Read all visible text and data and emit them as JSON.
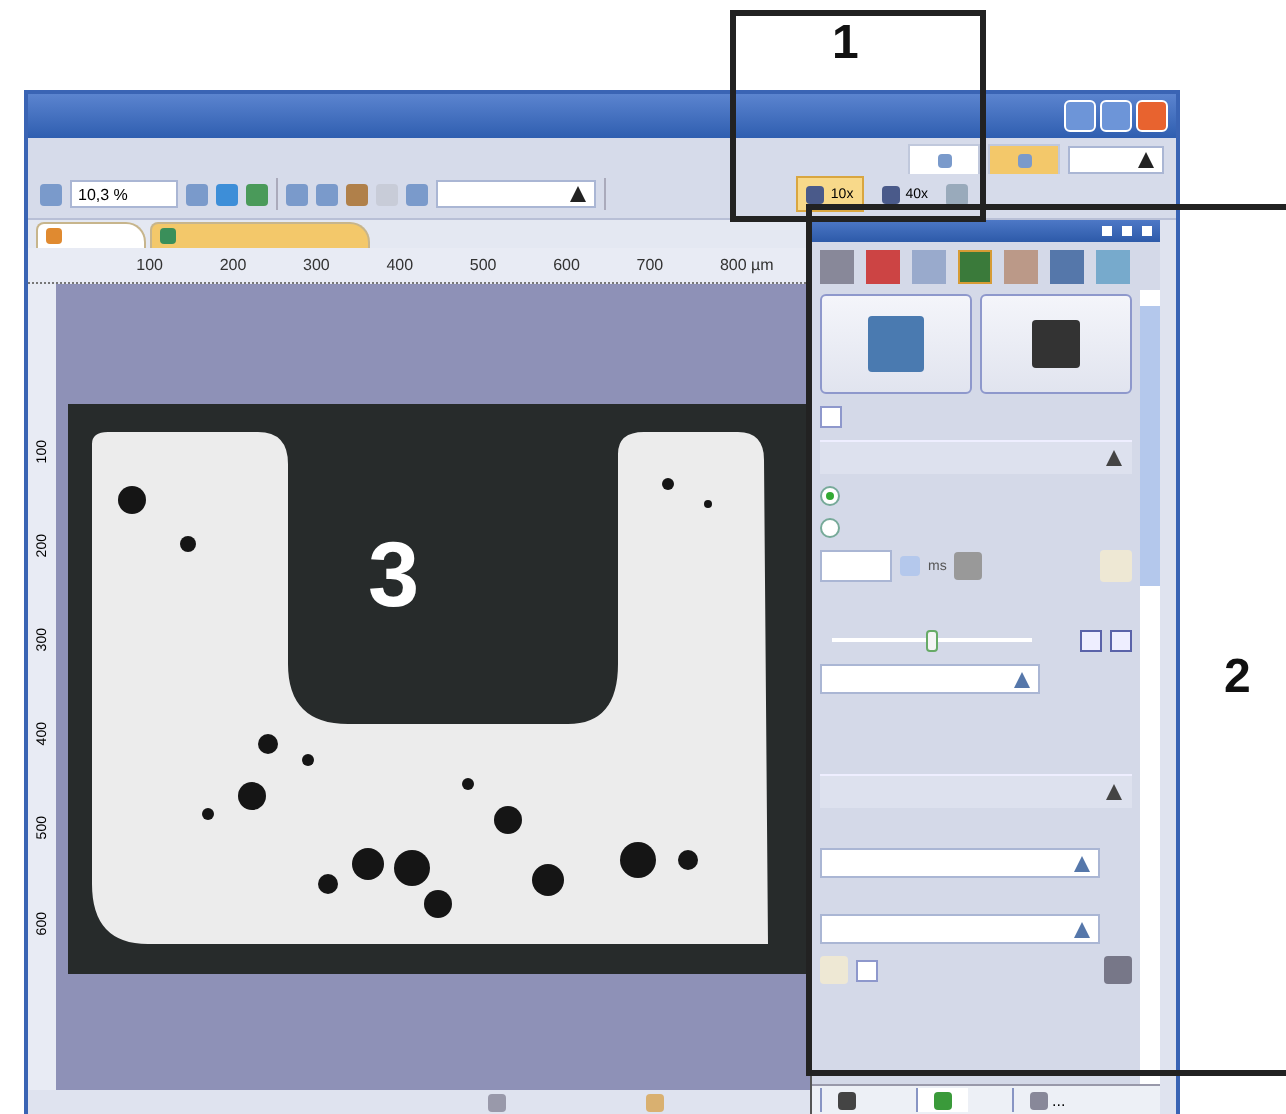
{
  "callouts": [
    {
      "label": "1"
    },
    {
      "label": "2"
    },
    {
      "label": "3"
    }
  ],
  "ribbon": {
    "zoom_value": "10,3 %",
    "objectives": [
      {
        "label": "10x",
        "selected": true
      },
      {
        "label": "40x",
        "selected": false
      }
    ]
  },
  "document_tabs": [
    {
      "selected": false
    },
    {
      "selected": true
    }
  ],
  "ruler": {
    "x_labels": [
      "100",
      "200",
      "300",
      "400",
      "500",
      "600",
      "700",
      "800 µm"
    ],
    "y_labels": [
      "100",
      "200",
      "300",
      "400",
      "500",
      "600"
    ]
  },
  "panel": {
    "tools": [
      {
        "selected": false
      },
      {
        "selected": false
      },
      {
        "selected": false
      },
      {
        "selected": true
      },
      {
        "selected": false
      },
      {
        "selected": false
      },
      {
        "selected": false
      }
    ],
    "show_checkbox": {
      "checked": false
    },
    "modes": [
      {
        "selected": true
      },
      {
        "selected": false
      }
    ],
    "exposure_unit": "ms",
    "gain": {
      "level": 0.5
    },
    "option_checkbox": {
      "checked": false
    },
    "bottom_tabs": [
      {
        "selected": false
      },
      {
        "selected": true
      },
      {
        "label": "...",
        "selected": false
      }
    ]
  }
}
